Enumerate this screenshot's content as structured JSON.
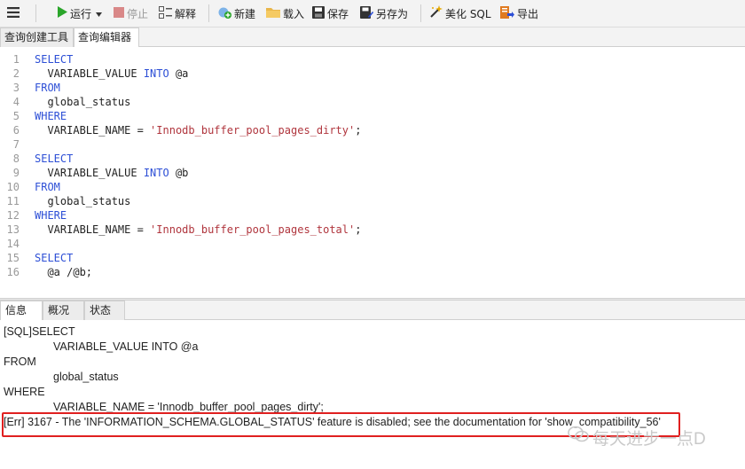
{
  "toolbar": {
    "run": "运行",
    "stop": "停止",
    "explain": "解释",
    "new": "新建",
    "load": "载入",
    "save": "保存",
    "save_as": "另存为",
    "beautify": "美化 SQL",
    "export": "导出",
    "colors": {
      "run": "#2aa52a",
      "stop": "#d98888",
      "accent": "#2d4fd6"
    }
  },
  "tabs": [
    "查询创建工具",
    "查询编辑器"
  ],
  "editor": {
    "lines": [
      {
        "n": "1",
        "kw": "SELECT",
        "text": "",
        "str": "",
        "tail": ""
      },
      {
        "n": "2",
        "kw": "",
        "text": "  VARIABLE_VALUE ",
        "kw2": "INTO",
        "tail": " @a"
      },
      {
        "n": "3",
        "kw": "FROM",
        "text": "",
        "tail": ""
      },
      {
        "n": "4",
        "kw": "",
        "text": "  global_status",
        "tail": ""
      },
      {
        "n": "5",
        "kw": "WHERE",
        "text": "",
        "tail": ""
      },
      {
        "n": "6",
        "kw": "",
        "text": "  VARIABLE_NAME = ",
        "str": "'Innodb_buffer_pool_pages_dirty'",
        "tail": ";"
      },
      {
        "n": "7",
        "kw": "",
        "text": "",
        "tail": ""
      },
      {
        "n": "8",
        "kw": "SELECT",
        "text": "",
        "tail": ""
      },
      {
        "n": "9",
        "kw": "",
        "text": "  VARIABLE_VALUE ",
        "kw2": "INTO",
        "tail": " @b"
      },
      {
        "n": "10",
        "kw": "FROM",
        "text": "",
        "tail": ""
      },
      {
        "n": "11",
        "kw": "",
        "text": "  global_status",
        "tail": ""
      },
      {
        "n": "12",
        "kw": "WHERE",
        "text": "",
        "tail": ""
      },
      {
        "n": "13",
        "kw": "",
        "text": "  VARIABLE_NAME = ",
        "str": "'Innodb_buffer_pool_pages_total'",
        "tail": ";"
      },
      {
        "n": "14",
        "kw": "",
        "text": "",
        "tail": ""
      },
      {
        "n": "15",
        "kw": "SELECT",
        "text": "",
        "tail": ""
      },
      {
        "n": "16",
        "kw": "",
        "text": "  @a /@b;",
        "tail": ""
      }
    ]
  },
  "bottom_tabs": [
    "信息",
    "概况",
    "状态"
  ],
  "messages": {
    "l1": "[SQL]SELECT",
    "l2": "VARIABLE_VALUE INTO @a",
    "l3": "FROM",
    "l4": "global_status",
    "l5": "WHERE",
    "l6": "VARIABLE_NAME = 'Innodb_buffer_pool_pages_dirty';",
    "err": "[Err] 3167 - The 'INFORMATION_SCHEMA.GLOBAL_STATUS' feature is disabled; see the documentation for 'show_compatibility_56'",
    "error_color": "#e02020"
  },
  "watermark": "每天进步一点D"
}
